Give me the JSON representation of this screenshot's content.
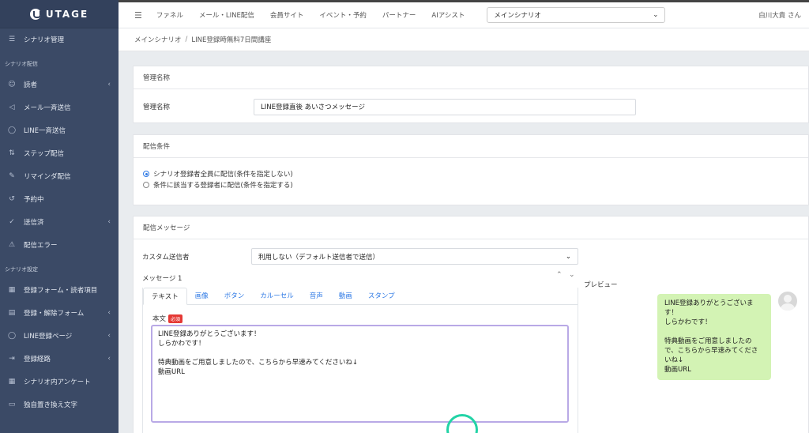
{
  "brand": {
    "name": "UTAGE"
  },
  "sidebar": {
    "items": [
      {
        "label": "シナリオ管理",
        "icon": "list-icon",
        "chev": false
      },
      {
        "section": "シナリオ配信"
      },
      {
        "label": "読者",
        "icon": "users-icon",
        "chev": true
      },
      {
        "label": "メール一斉送信",
        "icon": "send-icon",
        "chev": false
      },
      {
        "label": "LINE一斉送信",
        "icon": "chat-icon",
        "chev": false
      },
      {
        "label": "ステップ配信",
        "icon": "sort-icon",
        "chev": false
      },
      {
        "label": "リマインダ配信",
        "icon": "pencil-icon",
        "chev": false
      },
      {
        "label": "予約中",
        "icon": "history-icon",
        "chev": false
      },
      {
        "label": "送信済",
        "icon": "check-icon",
        "chev": true
      },
      {
        "label": "配信エラー",
        "icon": "warning-icon",
        "chev": false
      },
      {
        "section": "シナリオ設定"
      },
      {
        "label": "登録フォーム・読者項目",
        "icon": "table-icon",
        "chev": false
      },
      {
        "label": "登録・解除フォーム",
        "icon": "form-icon",
        "chev": true
      },
      {
        "label": "LINE登録ページ",
        "icon": "chat-icon",
        "chev": true
      },
      {
        "label": "登録経路",
        "icon": "signin-icon",
        "chev": true
      },
      {
        "label": "シナリオ内アンケート",
        "icon": "table-icon",
        "chev": false
      },
      {
        "label": "独自置き換え文字",
        "icon": "doc-icon",
        "chev": false
      }
    ]
  },
  "topbar": {
    "links": [
      "ファネル",
      "メール・LINE配信",
      "会員サイト",
      "イベント・予約",
      "パートナー",
      "AIアシスト"
    ],
    "scenario": "メインシナリオ",
    "user": "白川大貴 さん"
  },
  "breadcrumb": {
    "parent": "メインシナリオ",
    "separator": "/",
    "current": "LINE登録時無料7日間講座"
  },
  "admin": {
    "header": "管理名称",
    "label": "管理名称",
    "value": "LINE登録直後 あいさつメッセージ"
  },
  "conditions": {
    "header": "配信条件",
    "options": [
      {
        "label": "シナリオ登録者全員に配信(条件を指定しない)",
        "selected": true
      },
      {
        "label": "条件に該当する登録者に配信(条件を指定する)",
        "selected": false
      }
    ]
  },
  "message": {
    "header": "配信メッセージ",
    "sender_label": "カスタム送信者",
    "sender_value": "利用しない（デフォルト送信者で送信）",
    "message_title": "メッセージ 1",
    "tabs": [
      "テキスト",
      "画像",
      "ボタン",
      "カルーセル",
      "音声",
      "動画",
      "スタンプ"
    ],
    "active_tab": 0,
    "body_label": "本文",
    "required_badge": "必須",
    "body_text": "LINE登録ありがとうございます！\nしらかわです！\n\n特典動画をご用意しましたので、こちらから早速みてくださいね↓\n動画URL"
  },
  "preview": {
    "label": "プレビュー",
    "bubble_text": "LINE登録ありがとうございま\nす！\nしらかわです！\n\n特典動画をご用意しましたの\nで、こちらから早速みてくださ\nいね↓\n動画URL"
  }
}
